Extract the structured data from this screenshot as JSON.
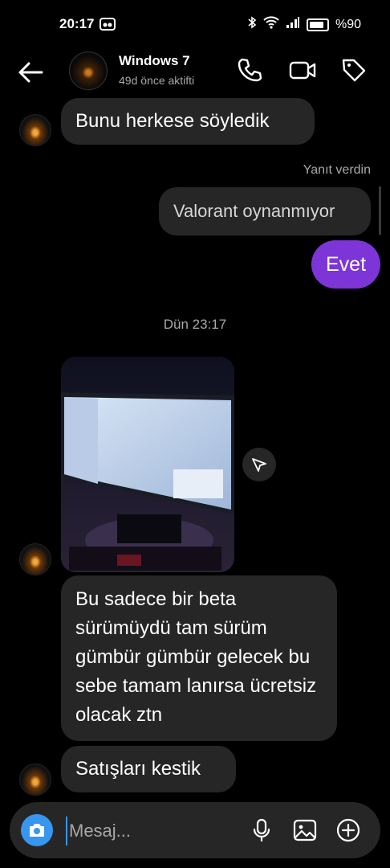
{
  "status_bar": {
    "time": "20:17",
    "battery": "%90"
  },
  "header": {
    "contact_name": "Windows 7",
    "contact_status": "49d önce aktifti"
  },
  "messages": {
    "m1": "Bunu herkese söyledik",
    "reply_label": "Yanıt verdin",
    "m2_quoted": "Valorant oynanmıyor",
    "m3": "Evet",
    "timestamp": "Dün 23:17",
    "m4": "Bu sadece bir beta sürümüydü tam sürüm gümbür gümbür gelecek bu sebe tamam lanırsa ücretsiz olacak ztn",
    "m5": "Satışları kestik"
  },
  "composer": {
    "placeholder": "Mesaj..."
  },
  "colors": {
    "accent_purple": "#7e35d8",
    "bubble_grey": "#262626",
    "camera_blue": "#3797f0"
  },
  "icons": {
    "back": "arrow-left-icon",
    "call": "phone-icon",
    "video": "video-camera-icon",
    "tag": "tag-icon",
    "share": "send-icon",
    "camera": "camera-icon",
    "mic": "microphone-icon",
    "gallery": "gallery-icon",
    "add": "plus-circle-icon"
  }
}
